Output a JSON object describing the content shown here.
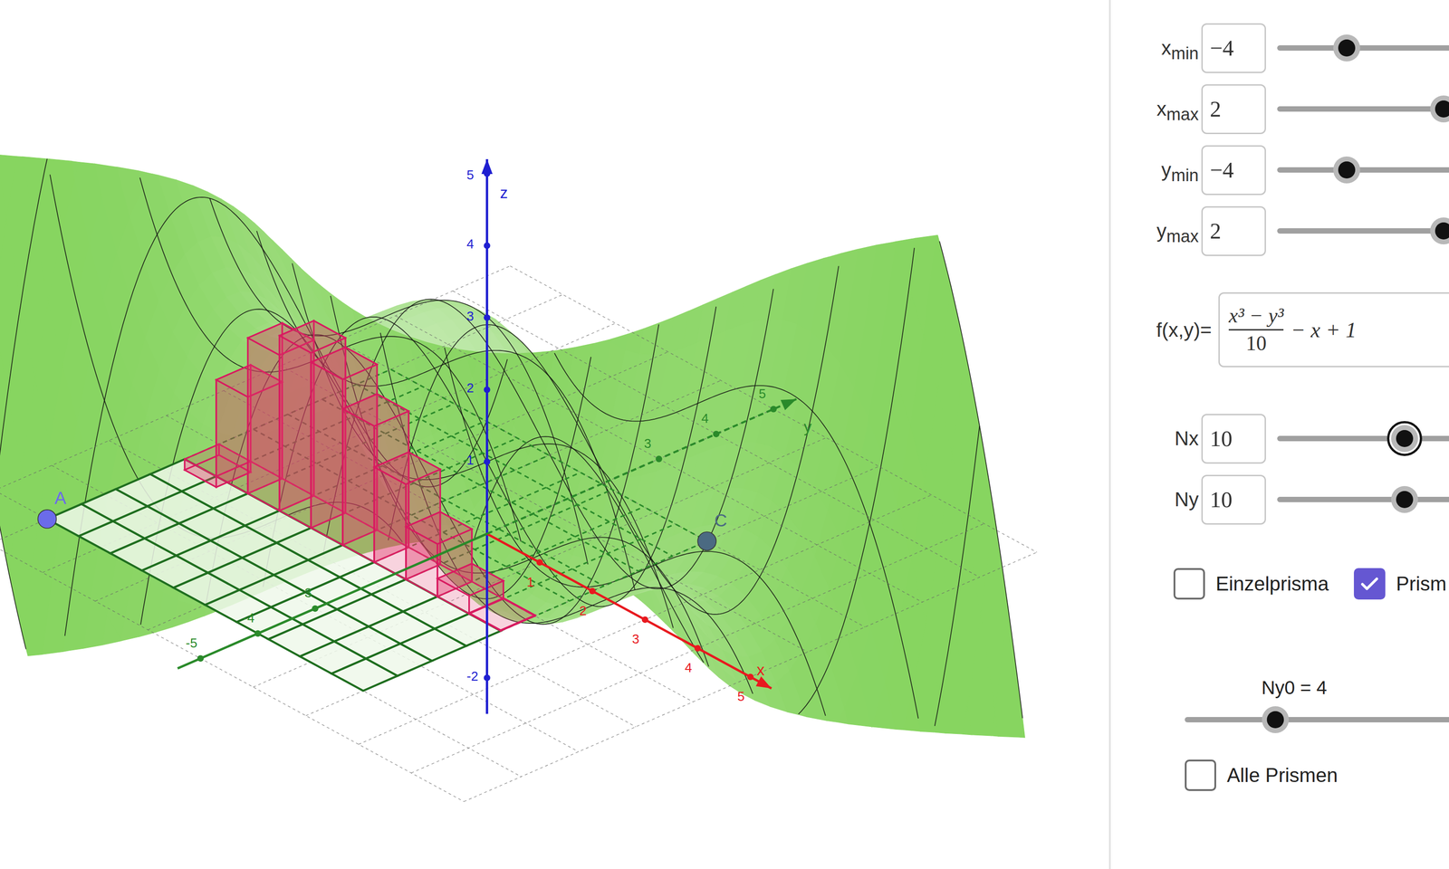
{
  "graphics": {
    "axes": [
      {
        "name": "x",
        "label": "x",
        "color": "#e8191f",
        "ticks": [
          {
            "label": "1",
            "value": 1
          },
          {
            "label": "2",
            "value": 2
          },
          {
            "label": "3",
            "value": 3
          },
          {
            "label": "4",
            "value": 4
          },
          {
            "label": "5",
            "value": 5
          }
        ]
      },
      {
        "name": "y",
        "label": "y",
        "color": "#2a8a2a",
        "ticks": [
          {
            "label": "-5",
            "value": -5
          },
          {
            "label": "-4",
            "value": -4
          },
          {
            "label": "-3",
            "value": -3
          },
          {
            "label": "3",
            "value": 3
          },
          {
            "label": "4",
            "value": 4
          },
          {
            "label": "5",
            "value": 5
          }
        ]
      },
      {
        "name": "z",
        "label": "z",
        "color": "#1f1fd1",
        "ticks": [
          {
            "label": "5",
            "value": 5
          },
          {
            "label": "4",
            "value": 4
          },
          {
            "label": "3",
            "value": 3
          },
          {
            "label": "2",
            "value": 2
          },
          {
            "label": "1",
            "value": 1
          },
          {
            "label": "-2",
            "value": -2
          }
        ]
      }
    ],
    "points": [
      {
        "label": "A",
        "color": "#6b6bea"
      },
      {
        "label": "C",
        "color": "#4b6a82"
      }
    ],
    "prisms": {
      "row": 4,
      "heights": [
        -0.15,
        1.34,
        2.16,
        2.43,
        2.3,
        1.89,
        1.32,
        0.73,
        0.25,
        0.01
      ]
    }
  },
  "range_sliders": [
    {
      "label": "x",
      "sub": "min",
      "value": "−4",
      "level": 0.25,
      "focused": false
    },
    {
      "label": "x",
      "sub": "max",
      "value": "2",
      "level": 0.6,
      "focused": false
    },
    {
      "label": "y",
      "sub": "min",
      "value": "−4",
      "level": 0.25,
      "focused": false
    },
    {
      "label": "y",
      "sub": "max",
      "value": "2",
      "level": 0.6,
      "focused": false
    }
  ],
  "function": {
    "label": "f(x,y)=",
    "numerator": "x³ − y³",
    "denominator": "10",
    "rest": "− x + 1"
  },
  "count_sliders": [
    {
      "label": "Nx",
      "sub": "",
      "value": "10",
      "level": 0.46,
      "focused": true
    },
    {
      "label": "Ny",
      "sub": "",
      "value": "10",
      "level": 0.46,
      "focused": false
    }
  ],
  "prism_checkboxes": [
    {
      "label": "Einzelprisma",
      "checked": false
    },
    {
      "label": "Prism",
      "checked": true
    }
  ],
  "row_slider": {
    "label": "Ny0 = 4",
    "level": 0.245
  },
  "all_checkbox": {
    "label": "Alle Prismen",
    "checked": false
  }
}
